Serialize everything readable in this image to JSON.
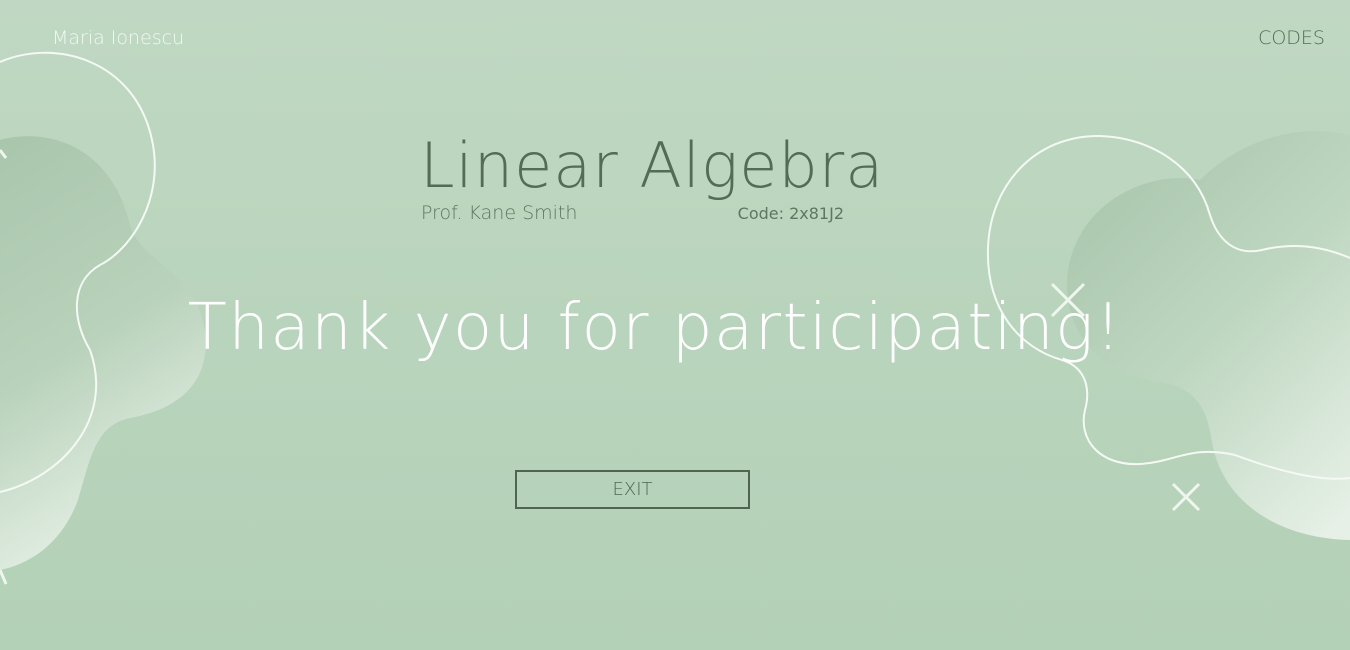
{
  "header": {
    "user_name": "Maria Ionescu",
    "codes_label": "CODES"
  },
  "course": {
    "title": "Linear Algebra",
    "professor": "Prof. Kane Smith",
    "code": "Code: 2x81J2"
  },
  "main": {
    "message": "Thank you for participating!",
    "exit_label": "EXIT"
  },
  "colors": {
    "background": "#b9d4bc",
    "accent_dark": "#546b54",
    "text_light": "#ffffff"
  }
}
